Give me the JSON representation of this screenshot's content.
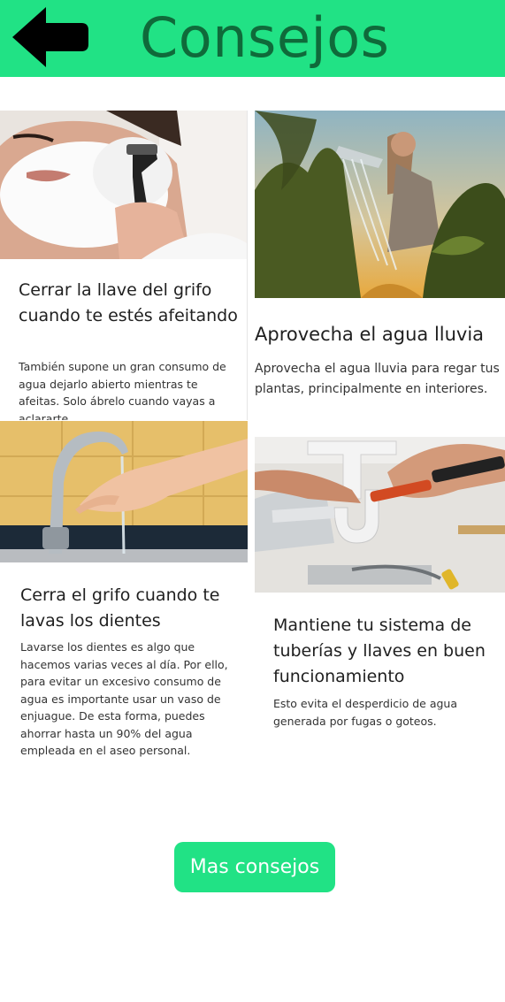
{
  "header": {
    "title": "Consejos",
    "back_icon": "arrow-left-icon",
    "background": "#21e285",
    "title_color": "#0f6a3a"
  },
  "tips": [
    {
      "title": "Cerrar la llave del grifo cuando te estés afeitando",
      "description": "También supone un gran consumo de agua dejarlo abierto mientras te afeitas. Solo ábrelo cuando vayas a aclararte.",
      "image": "man-shaving-photo"
    },
    {
      "title": "Aprovecha el agua lluvia",
      "description": "Aprovecha el agua lluvia para regar tus plantas, principalmente en interiores.",
      "image": "watering-plants-photo"
    },
    {
      "title": "Cerra el grifo cuando te lavas los dientes",
      "description": "Lavarse los dientes es algo que hacemos varias veces al día. Por ello, para evitar un excesivo consumo de agua es importante usar un vaso de enjuague. De esta forma, puedes ahorrar hasta un 90% del agua empleada en el aseo personal.",
      "image": "faucet-hand-photo"
    },
    {
      "title": "Mantiene tu sistema de tuberías y llaves en buen funcionamiento",
      "description": "Esto evita el desperdicio de agua generada por fugas o goteos.",
      "image": "pipe-repair-photo"
    }
  ],
  "more_button": {
    "label": "Mas consejos"
  }
}
